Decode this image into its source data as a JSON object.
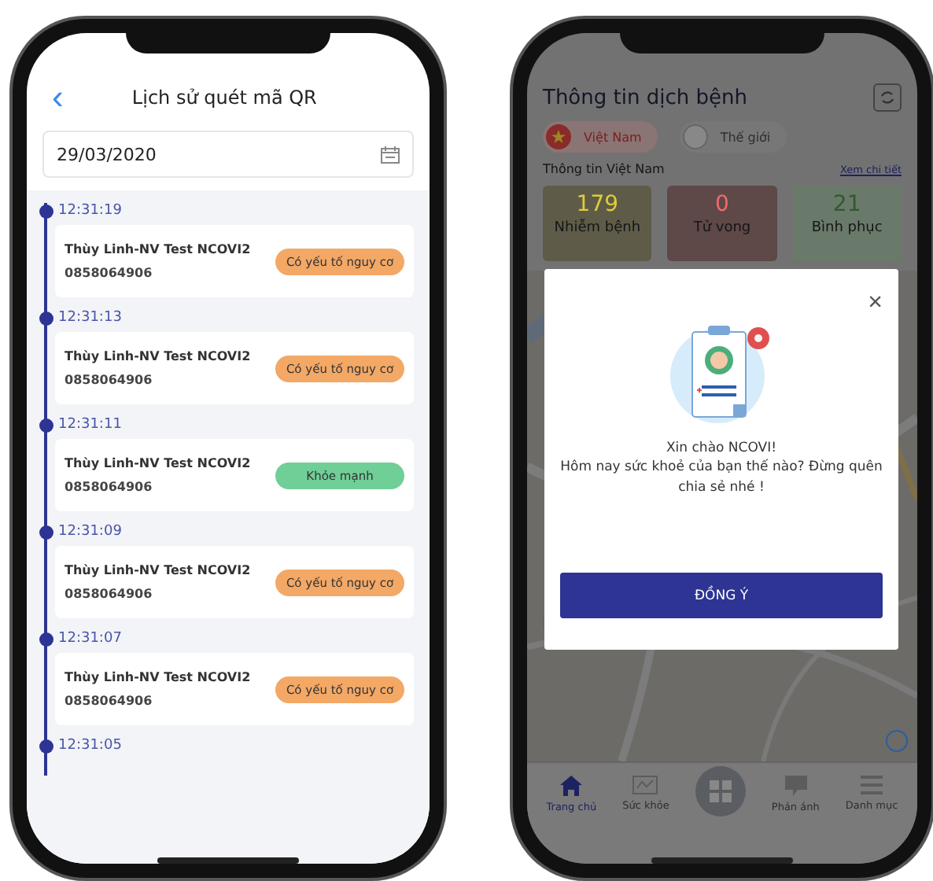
{
  "history_screen": {
    "back": "‹",
    "title": "Lịch sử quét mã QR",
    "date": "29/03/2020",
    "entries": [
      {
        "time": "12:31:19",
        "name": "Thùy Linh-NV Test NCOVI2",
        "phone": "0858064906",
        "status": {
          "kind": "risk",
          "label": "Có yếu tố nguy cơ"
        }
      },
      {
        "time": "12:31:13",
        "name": "Thùy Linh-NV Test NCOVI2",
        "phone": "0858064906",
        "status": {
          "kind": "risk",
          "label": "Có yếu tố nguy cơ"
        }
      },
      {
        "time": "12:31:11",
        "name": "Thùy Linh-NV Test NCOVI2",
        "phone": "0858064906",
        "status": {
          "kind": "healthy",
          "label": "Khỏe mạnh"
        }
      },
      {
        "time": "12:31:09",
        "name": "Thùy Linh-NV Test NCOVI2",
        "phone": "0858064906",
        "status": {
          "kind": "risk",
          "label": "Có yếu tố nguy cơ"
        }
      },
      {
        "time": "12:31:07",
        "name": "Thùy Linh-NV Test NCOVI2",
        "phone": "0858064906",
        "status": {
          "kind": "risk",
          "label": "Có yếu tố nguy cơ"
        }
      },
      {
        "time": "12:31:05"
      }
    ]
  },
  "home_screen": {
    "title": "Thông tin dịch bệnh",
    "regions": [
      {
        "label": "Việt Nam",
        "selected": true
      },
      {
        "label": "Thế giới",
        "selected": false
      }
    ],
    "section_title": "Thông tin Việt Nam",
    "detail_link": "Xem chi tiết",
    "stats": [
      {
        "value": "179",
        "label": "Nhiễm bệnh",
        "color": "#e0cc3a"
      },
      {
        "value": "0",
        "label": "Tử vong",
        "color": "#f06a6a"
      },
      {
        "value": "21",
        "label": "Bình phục",
        "color": "#2f5a2f"
      }
    ],
    "dialog": {
      "close": "×",
      "greeting": "Xin chào NCOVI!",
      "message": "Hôm nay sức khoẻ của bạn thế nào? Đừng quên chia sẻ nhé !",
      "button": "ĐỒNG Ý"
    },
    "nav": [
      {
        "kind": "home",
        "label": "Trang chủ",
        "selected": true
      },
      {
        "kind": "health",
        "label": "Sức khỏe",
        "selected": false
      },
      {
        "kind": "scan",
        "selected": false
      },
      {
        "kind": "feedback",
        "label": "Phản ánh",
        "selected": false
      },
      {
        "kind": "menu",
        "label": "Danh mục",
        "selected": false
      }
    ]
  }
}
